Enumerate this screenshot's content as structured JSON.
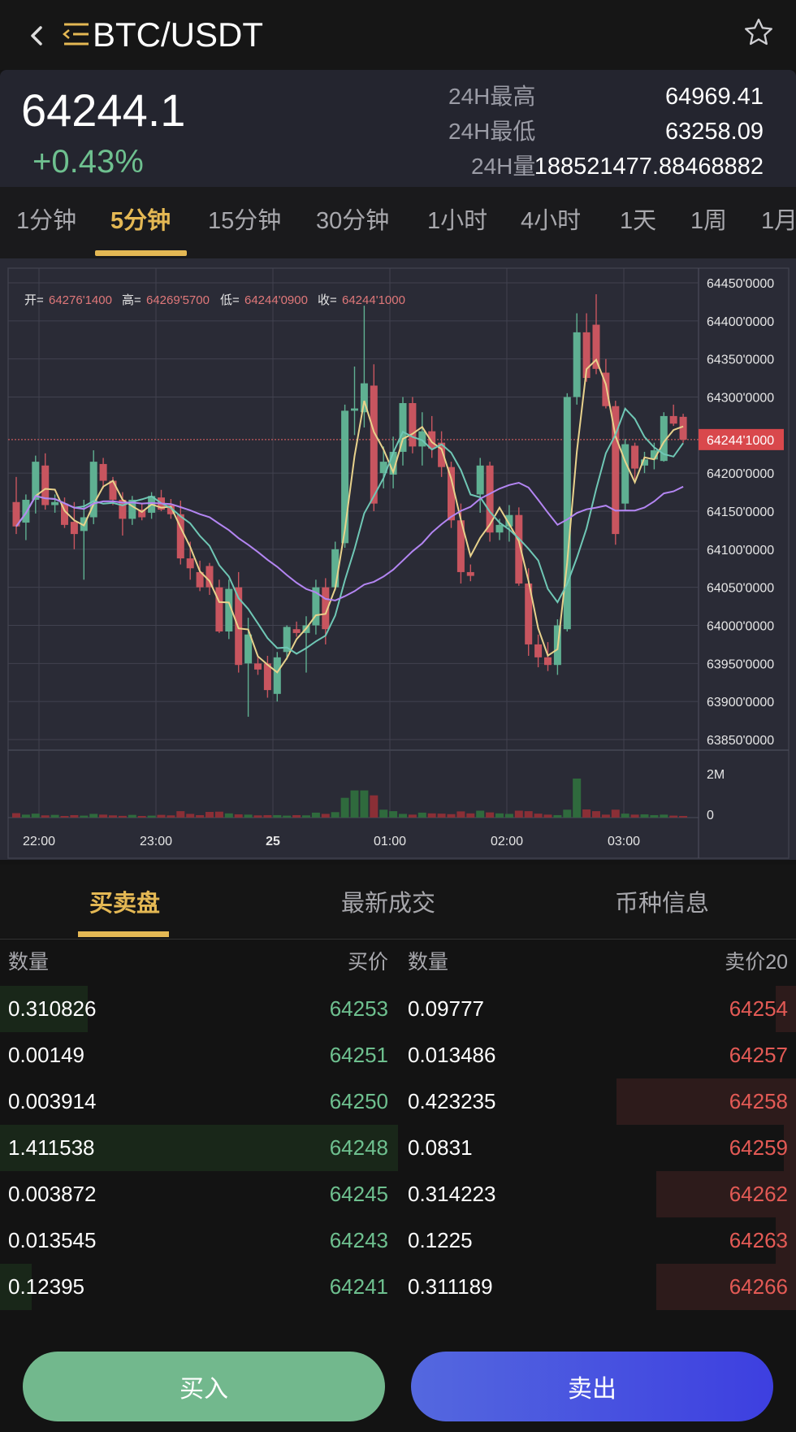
{
  "header": {
    "pair": "BTC/USDT",
    "icons": [
      "back-icon",
      "menu-icon",
      "star-icon"
    ]
  },
  "ticker": {
    "last_price": "64244.1",
    "change_pct": "+0.43%",
    "high_label": "24H最高",
    "high_value": "64969.41",
    "low_label": "24H最低",
    "low_value": "63258.09",
    "vol_label": "24H量",
    "vol_value": "188521477.88468882"
  },
  "timeframes": [
    "1分钟",
    "5分钟",
    "15分钟",
    "30分钟",
    "1小时",
    "4小时",
    "1天",
    "1周",
    "1月"
  ],
  "active_timeframe": "5分钟",
  "chart_data": {
    "type": "candlestick",
    "ohlc_legend": [
      {
        "label": "开=",
        "value": "64276'1400"
      },
      {
        "label": "高=",
        "value": "64269'5700"
      },
      {
        "label": "低=",
        "value": "64244'0900"
      },
      {
        "label": "收=",
        "value": "64244'1000"
      }
    ],
    "y_ticks": [
      "64450'0000",
      "64400'0000",
      "64350'0000",
      "64300'0000",
      "64244'1000",
      "64200'0000",
      "64150'0000",
      "64100'0000",
      "64050'0000",
      "64000'0000",
      "63950'0000",
      "63900'0000",
      "63850'0000"
    ],
    "y_tick_values": [
      64450,
      64400,
      64350,
      64300,
      64244.1,
      64200,
      64150,
      64100,
      64050,
      64000,
      63950,
      63900,
      63850
    ],
    "current_price_label": "64244'1000",
    "current_price": 64244.1,
    "ylim": [
      63850,
      64450
    ],
    "x_ticks": [
      "22:00",
      "23:00",
      "25",
      "01:00",
      "02:00",
      "03:00"
    ],
    "volume_ticks": [
      "2M",
      "0"
    ],
    "volume_ylim": [
      0,
      2500000
    ],
    "ma_colors": {
      "ma_fast": "#e8d28c",
      "ma_mid": "#6fc7b5",
      "ma_slow": "#b385f2"
    },
    "candles": [
      {
        "o": 64162,
        "h": 64195,
        "l": 64120,
        "c": 64130
      },
      {
        "o": 64135,
        "h": 64172,
        "l": 64112,
        "c": 64165
      },
      {
        "o": 64165,
        "h": 64223,
        "l": 64147,
        "c": 64215
      },
      {
        "o": 64210,
        "h": 64226,
        "l": 64152,
        "c": 64158
      },
      {
        "o": 64158,
        "h": 64172,
        "l": 64148,
        "c": 64162
      },
      {
        "o": 64160,
        "h": 64168,
        "l": 64128,
        "c": 64132
      },
      {
        "o": 64136,
        "h": 64162,
        "l": 64100,
        "c": 64120
      },
      {
        "o": 64124,
        "h": 64165,
        "l": 64060,
        "c": 64142
      },
      {
        "o": 64142,
        "h": 64230,
        "l": 64133,
        "c": 64215
      },
      {
        "o": 64212,
        "h": 64220,
        "l": 64180,
        "c": 64190
      },
      {
        "o": 64190,
        "h": 64195,
        "l": 64158,
        "c": 64165
      },
      {
        "o": 64165,
        "h": 64175,
        "l": 64118,
        "c": 64140
      },
      {
        "o": 64140,
        "h": 64170,
        "l": 64132,
        "c": 64165
      },
      {
        "o": 64152,
        "h": 64160,
        "l": 64138,
        "c": 64142
      },
      {
        "o": 64148,
        "h": 64175,
        "l": 64140,
        "c": 64170
      },
      {
        "o": 64168,
        "h": 64178,
        "l": 64150,
        "c": 64152
      },
      {
        "o": 64158,
        "h": 64166,
        "l": 64140,
        "c": 64146
      },
      {
        "o": 64146,
        "h": 64164,
        "l": 64080,
        "c": 64088
      },
      {
        "o": 64088,
        "h": 64110,
        "l": 64060,
        "c": 64075
      },
      {
        "o": 64070,
        "h": 64085,
        "l": 64045,
        "c": 64050
      },
      {
        "o": 64078,
        "h": 64082,
        "l": 64040,
        "c": 64050
      },
      {
        "o": 64050,
        "h": 64060,
        "l": 63990,
        "c": 63992
      },
      {
        "o": 63992,
        "h": 64060,
        "l": 63982,
        "c": 64048
      },
      {
        "o": 64050,
        "h": 64070,
        "l": 63938,
        "c": 63948
      },
      {
        "o": 63950,
        "h": 64010,
        "l": 63880,
        "c": 63988
      },
      {
        "o": 63950,
        "h": 63960,
        "l": 63935,
        "c": 63942
      },
      {
        "o": 63950,
        "h": 63960,
        "l": 63905,
        "c": 63915
      },
      {
        "o": 63910,
        "h": 63965,
        "l": 63900,
        "c": 63958
      },
      {
        "o": 63965,
        "h": 64000,
        "l": 63955,
        "c": 63998
      },
      {
        "o": 63995,
        "h": 64005,
        "l": 63985,
        "c": 63990
      },
      {
        "o": 63990,
        "h": 64012,
        "l": 63938,
        "c": 64000
      },
      {
        "o": 64000,
        "h": 64060,
        "l": 63988,
        "c": 64050
      },
      {
        "o": 64050,
        "h": 64062,
        "l": 63975,
        "c": 63995
      },
      {
        "o": 64050,
        "h": 64110,
        "l": 64046,
        "c": 64100
      },
      {
        "o": 64108,
        "h": 64290,
        "l": 64102,
        "c": 64282
      },
      {
        "o": 64282,
        "h": 64340,
        "l": 64250,
        "c": 64285
      },
      {
        "o": 64280,
        "h": 64420,
        "l": 64260,
        "c": 64318
      },
      {
        "o": 64315,
        "h": 64343,
        "l": 64150,
        "c": 64160
      },
      {
        "o": 64200,
        "h": 64235,
        "l": 64180,
        "c": 64215
      },
      {
        "o": 64198,
        "h": 64248,
        "l": 64180,
        "c": 64228
      },
      {
        "o": 64228,
        "h": 64300,
        "l": 64210,
        "c": 64292
      },
      {
        "o": 64292,
        "h": 64300,
        "l": 64226,
        "c": 64235
      },
      {
        "o": 64235,
        "h": 64280,
        "l": 64210,
        "c": 64255
      },
      {
        "o": 64255,
        "h": 64275,
        "l": 64220,
        "c": 64232
      },
      {
        "o": 64240,
        "h": 64255,
        "l": 64195,
        "c": 64208
      },
      {
        "o": 64208,
        "h": 64215,
        "l": 64128,
        "c": 64138
      },
      {
        "o": 64138,
        "h": 64160,
        "l": 64055,
        "c": 64070
      },
      {
        "o": 64070,
        "h": 64080,
        "l": 64058,
        "c": 64065
      },
      {
        "o": 64172,
        "h": 64220,
        "l": 64148,
        "c": 64210
      },
      {
        "o": 64210,
        "h": 64215,
        "l": 64110,
        "c": 64122
      },
      {
        "o": 64122,
        "h": 64140,
        "l": 64112,
        "c": 64132
      },
      {
        "o": 64130,
        "h": 64158,
        "l": 64110,
        "c": 64145
      },
      {
        "o": 64145,
        "h": 64155,
        "l": 64052,
        "c": 64055
      },
      {
        "o": 64055,
        "h": 64075,
        "l": 63960,
        "c": 63975
      },
      {
        "o": 63975,
        "h": 63988,
        "l": 63945,
        "c": 63958
      },
      {
        "o": 63958,
        "h": 63978,
        "l": 63940,
        "c": 63948
      },
      {
        "o": 63948,
        "h": 64008,
        "l": 63935,
        "c": 64000
      },
      {
        "o": 63995,
        "h": 64305,
        "l": 63992,
        "c": 64300
      },
      {
        "o": 64300,
        "h": 64410,
        "l": 64290,
        "c": 64385
      },
      {
        "o": 64385,
        "h": 64410,
        "l": 64320,
        "c": 64325
      },
      {
        "o": 64395,
        "h": 64435,
        "l": 64330,
        "c": 64337
      },
      {
        "o": 64332,
        "h": 64350,
        "l": 64285,
        "c": 64288
      },
      {
        "o": 64288,
        "h": 64295,
        "l": 64106,
        "c": 64120
      },
      {
        "o": 64160,
        "h": 64245,
        "l": 64150,
        "c": 64238
      },
      {
        "o": 64236,
        "h": 64240,
        "l": 64192,
        "c": 64206
      },
      {
        "o": 64210,
        "h": 64228,
        "l": 64200,
        "c": 64218
      },
      {
        "o": 64218,
        "h": 64240,
        "l": 64205,
        "c": 64230
      },
      {
        "o": 64216,
        "h": 64280,
        "l": 64215,
        "c": 64275
      },
      {
        "o": 64275,
        "h": 64290,
        "l": 64262,
        "c": 64265
      },
      {
        "o": 64274,
        "h": 64278,
        "l": 64240,
        "c": 64244
      }
    ],
    "volumes": [
      180000,
      120000,
      160000,
      90000,
      110000,
      60000,
      100000,
      80000,
      150000,
      120000,
      90000,
      70000,
      110000,
      60000,
      80000,
      110000,
      90000,
      260000,
      150000,
      100000,
      230000,
      240000,
      170000,
      130000,
      120000,
      90000,
      100000,
      100000,
      80000,
      100000,
      90000,
      200000,
      150000,
      220000,
      800000,
      1100000,
      1100000,
      900000,
      320000,
      260000,
      150000,
      120000,
      200000,
      170000,
      160000,
      140000,
      250000,
      170000,
      280000,
      210000,
      170000,
      150000,
      280000,
      260000,
      160000,
      120000,
      100000,
      320000,
      1580000,
      330000,
      260000,
      120000,
      320000,
      160000,
      120000,
      130000,
      100000,
      120000,
      80000,
      60000
    ]
  },
  "section_tabs": [
    "买卖盘",
    "最新成交",
    "币种信息"
  ],
  "active_section_tab": "买卖盘",
  "orderbook": {
    "bid_headers": {
      "qty": "数量",
      "price": "买价"
    },
    "ask_headers": {
      "qty": "数量",
      "price": "卖价20"
    },
    "bids": [
      {
        "qty": "0.310826",
        "price": "64253",
        "depth": 0.22
      },
      {
        "qty": "0.00149",
        "price": "64251",
        "depth": 0
      },
      {
        "qty": "0.003914",
        "price": "64250",
        "depth": 0
      },
      {
        "qty": "1.411538",
        "price": "64248",
        "depth": 1.0
      },
      {
        "qty": "0.003872",
        "price": "64245",
        "depth": 0
      },
      {
        "qty": "0.013545",
        "price": "64243",
        "depth": 0
      },
      {
        "qty": "0.12395",
        "price": "64241",
        "depth": 0.08
      }
    ],
    "asks": [
      {
        "qty": "0.09777",
        "price": "64254",
        "depth": 0.05
      },
      {
        "qty": "0.013486",
        "price": "64257",
        "depth": 0
      },
      {
        "qty": "0.423235",
        "price": "64258",
        "depth": 0.45
      },
      {
        "qty": "0.0831",
        "price": "64259",
        "depth": 0.03
      },
      {
        "qty": "0.314223",
        "price": "64262",
        "depth": 0.35
      },
      {
        "qty": "0.1225",
        "price": "64263",
        "depth": 0.05
      },
      {
        "qty": "0.311189",
        "price": "64266",
        "depth": 0.35
      }
    ]
  },
  "actions": {
    "buy_label": "买入",
    "sell_label": "卖出"
  }
}
